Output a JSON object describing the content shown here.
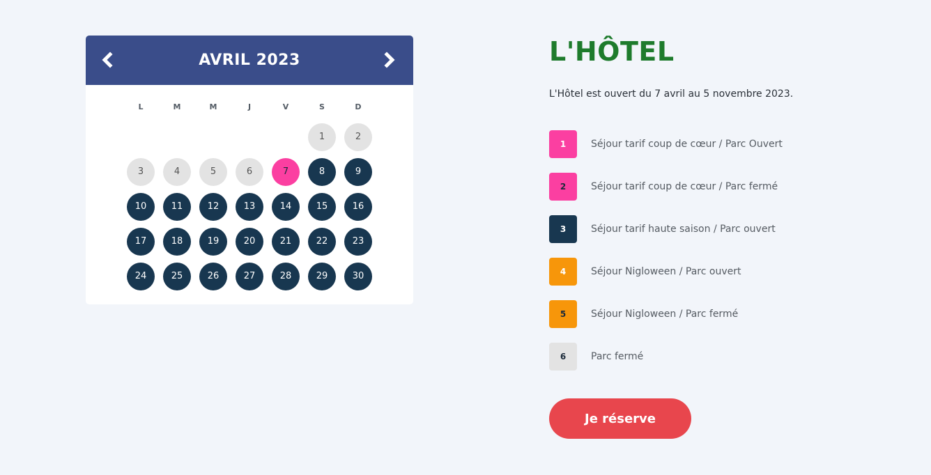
{
  "calendar": {
    "month_label": "AVRIL 2023",
    "prev_icon": "chevron-left-icon",
    "next_icon": "chevron-right-icon",
    "weekdays": [
      "L",
      "M",
      "M",
      "J",
      "V",
      "S",
      "D"
    ],
    "first_weekday_index": 5,
    "days": [
      {
        "label": "1",
        "status": "closed"
      },
      {
        "label": "2",
        "status": "closed"
      },
      {
        "label": "3",
        "status": "closed"
      },
      {
        "label": "4",
        "status": "closed"
      },
      {
        "label": "5",
        "status": "closed"
      },
      {
        "label": "6",
        "status": "closed"
      },
      {
        "label": "7",
        "status": "pink"
      },
      {
        "label": "8",
        "status": "navy"
      },
      {
        "label": "9",
        "status": "navy"
      },
      {
        "label": "10",
        "status": "navy"
      },
      {
        "label": "11",
        "status": "navy"
      },
      {
        "label": "12",
        "status": "navy"
      },
      {
        "label": "13",
        "status": "navy"
      },
      {
        "label": "14",
        "status": "navy"
      },
      {
        "label": "15",
        "status": "navy"
      },
      {
        "label": "16",
        "status": "navy"
      },
      {
        "label": "17",
        "status": "navy"
      },
      {
        "label": "18",
        "status": "navy"
      },
      {
        "label": "19",
        "status": "navy"
      },
      {
        "label": "20",
        "status": "navy"
      },
      {
        "label": "21",
        "status": "navy"
      },
      {
        "label": "22",
        "status": "navy"
      },
      {
        "label": "23",
        "status": "navy"
      },
      {
        "label": "24",
        "status": "navy"
      },
      {
        "label": "25",
        "status": "navy"
      },
      {
        "label": "26",
        "status": "navy"
      },
      {
        "label": "27",
        "status": "navy"
      },
      {
        "label": "28",
        "status": "navy"
      },
      {
        "label": "29",
        "status": "navy"
      },
      {
        "label": "30",
        "status": "navy"
      }
    ]
  },
  "hotel": {
    "title": "L'HÔTEL",
    "intro": "L'Hôtel est ouvert du 7 avril au 5 novembre 2023."
  },
  "legend": [
    {
      "number": "1",
      "label": "Séjour tarif coup de cœur / Parc Ouvert",
      "color": "#fb3fa1",
      "text_color": "#ffffff"
    },
    {
      "number": "2",
      "label": "Séjour tarif coup de cœur / Parc fermé",
      "color": "#fb3fa1",
      "text_color": "#1b2a3a"
    },
    {
      "number": "3",
      "label": "Séjour tarif haute saison / Parc ouvert",
      "color": "#183750",
      "text_color": "#ffffff"
    },
    {
      "number": "4",
      "label": "Séjour Nigloween / Parc ouvert",
      "color": "#f7960a",
      "text_color": "#ffffff"
    },
    {
      "number": "5",
      "label": "Séjour Nigloween / Parc fermé",
      "color": "#f7960a",
      "text_color": "#1b2a3a"
    },
    {
      "number": "6",
      "label": "Parc fermé",
      "color": "#e3e3e3",
      "text_color": "#1b2a3a"
    }
  ],
  "cta": {
    "label": "Je réserve"
  },
  "colors": {
    "background": "#f2f5fa",
    "header": "#3a4d8a",
    "title_green": "#1e7b2c",
    "cta_red": "#e8464d"
  }
}
